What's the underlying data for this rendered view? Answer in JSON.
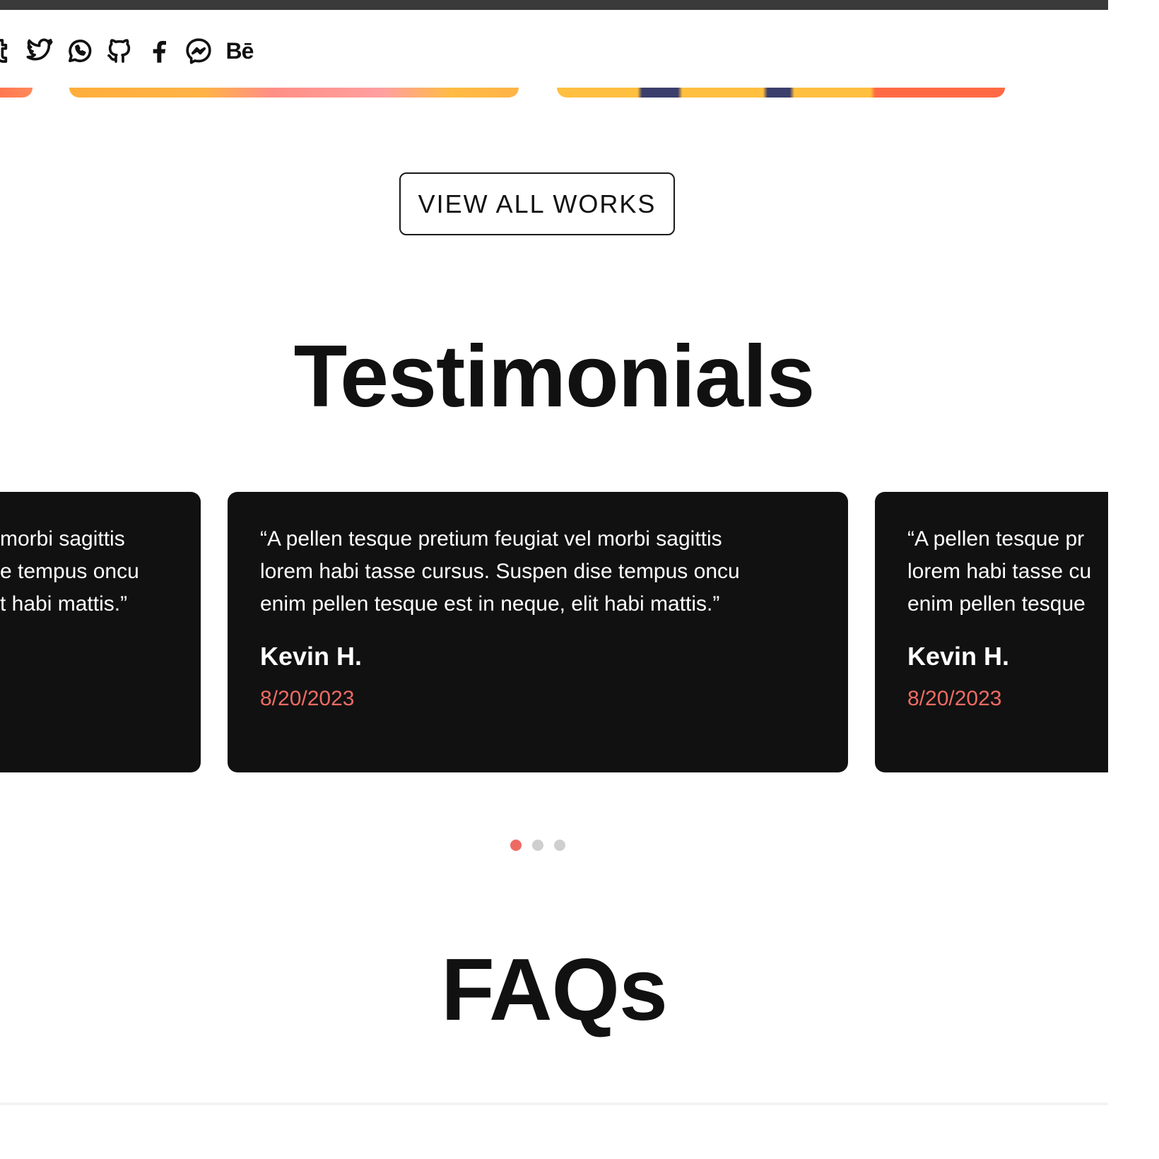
{
  "buttons": {
    "view_all_works": "VIEW ALL WORKS"
  },
  "social": {
    "icons": [
      "tumblr-icon",
      "twitter-icon",
      "whatsapp-icon",
      "github-icon",
      "facebook-icon",
      "messenger-icon",
      "behance-icon"
    ],
    "behance_label": "Bē"
  },
  "sections": {
    "testimonials_title": "Testimonials",
    "faqs_title": "FAQs"
  },
  "testimonials": [
    {
      "quote_lines": [
        "morbi sagittis",
        "e tempus oncu",
        "t habi mattis.”"
      ],
      "author": "",
      "date": ""
    },
    {
      "quote_lines": [
        "“A pellen tesque pretium feugiat vel morbi sagittis",
        "lorem habi tasse cursus. Suspen dise tempus oncu",
        "enim pellen tesque est in neque, elit habi mattis.”"
      ],
      "author": "Kevin H.",
      "date": "8/20/2023"
    },
    {
      "quote_lines": [
        "“A pellen tesque pr",
        "lorem habi tasse cu",
        "enim pellen tesque"
      ],
      "author": "Kevin H.",
      "date": "8/20/2023"
    }
  ],
  "carousel": {
    "active_index": 0,
    "dot_count": 3
  },
  "colors": {
    "accent": "#ee6b63",
    "card_bg": "#111111",
    "text": "#111111"
  }
}
